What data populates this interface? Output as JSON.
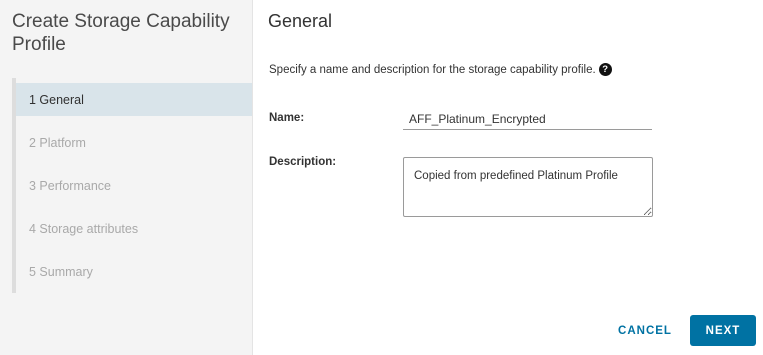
{
  "wizard": {
    "title": "Create Storage Capability Profile",
    "steps": [
      {
        "label": "1 General",
        "active": true
      },
      {
        "label": "2 Platform",
        "active": false
      },
      {
        "label": "3 Performance",
        "active": false
      },
      {
        "label": "4 Storage attributes",
        "active": false
      },
      {
        "label": "5 Summary",
        "active": false
      }
    ]
  },
  "general": {
    "title": "General",
    "intro": "Specify a name and description for the storage capability profile.",
    "help_icon": "help-circle-icon",
    "help_glyph": "?",
    "name_label": "Name:",
    "name_value": "AFF_Platinum_Encrypted",
    "description_label": "Description:",
    "description_value": "Copied from predefined Platinum Profile"
  },
  "footer": {
    "cancel_label": "CANCEL",
    "next_label": "NEXT"
  },
  "colors": {
    "accent": "#0072a3",
    "active_step_bg": "#d9e4ea",
    "sidebar_bg": "#f4f4f4"
  }
}
